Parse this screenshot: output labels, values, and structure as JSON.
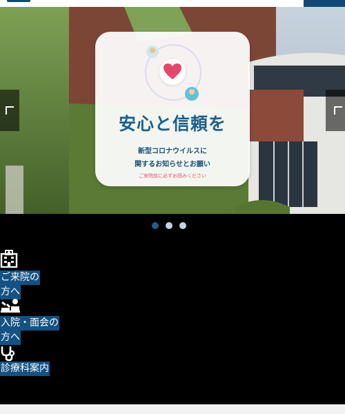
{
  "banner": {
    "title": "安心と信頼を",
    "subtitle_line1": "新型コロナウイルスに",
    "subtitle_line2": "関するお知らせとお願い",
    "note": "ご来院前に必ずお読みください"
  },
  "slider": {
    "total_slides": 3,
    "active_slide": 1
  },
  "nav": {
    "items": [
      {
        "icon": "hospital-building-icon",
        "label_line1": "ご来院の",
        "label_line2": "方へ"
      },
      {
        "icon": "patient-bed-icon",
        "label_line1": "入院・面会の",
        "label_line2": "方へ"
      },
      {
        "icon": "stethoscope-icon",
        "label_line1": "診療科案内"
      }
    ]
  },
  "colors": {
    "brand_blue": "#135283",
    "title_blue": "#1c5f8c",
    "heart_red": "#e8466a",
    "note_pink": "#e2556b"
  }
}
